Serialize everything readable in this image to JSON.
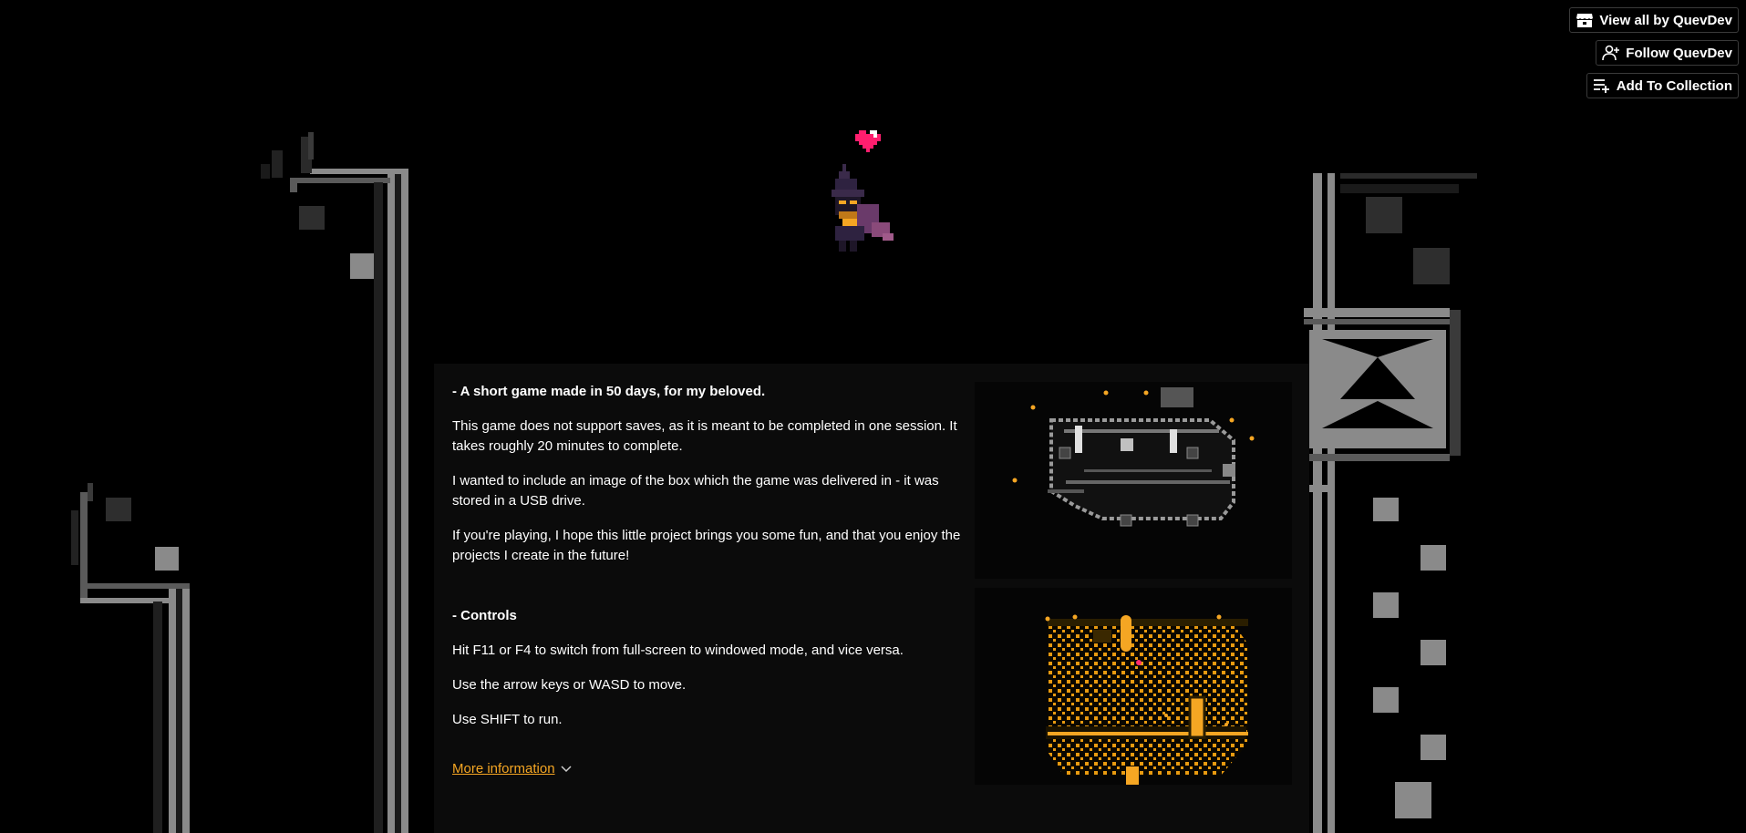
{
  "user_tools": {
    "view_all_label": "View all by QuevDev",
    "follow_label": "Follow QuevDev",
    "add_collection_label": "Add To Collection"
  },
  "description": {
    "intro_heading": "- A short game made in 50 days, for my beloved.",
    "para_saves": "This game does not support saves, as it is meant to be completed in one session. It takes roughly 20 minutes to complete.",
    "para_box": "I wanted to include an image of the box which the game was delivered in - it was stored in a USB drive.",
    "para_fun": "If you're playing, I hope this little project brings you some fun, and that you enjoy the projects I create in the future!",
    "controls_heading": "- Controls",
    "control_fullscreen": "Hit F11 or F4 to switch from full-screen to windowed mode, and vice versa.",
    "control_move": "Use the arrow keys or WASD to move.",
    "control_run": "Use SHIFT to run.",
    "more_info_label": "More information"
  },
  "icons": {
    "view_all": "itchio-icon",
    "follow": "follow-user-icon",
    "collection": "add-to-collection-icon",
    "more_info": "chevron-down-icon",
    "heart": "heart-icon"
  },
  "colors": {
    "accent": "#f5a623",
    "background": "#000000",
    "panel": "#0b0b0b",
    "heart": "#ff1e6e"
  }
}
